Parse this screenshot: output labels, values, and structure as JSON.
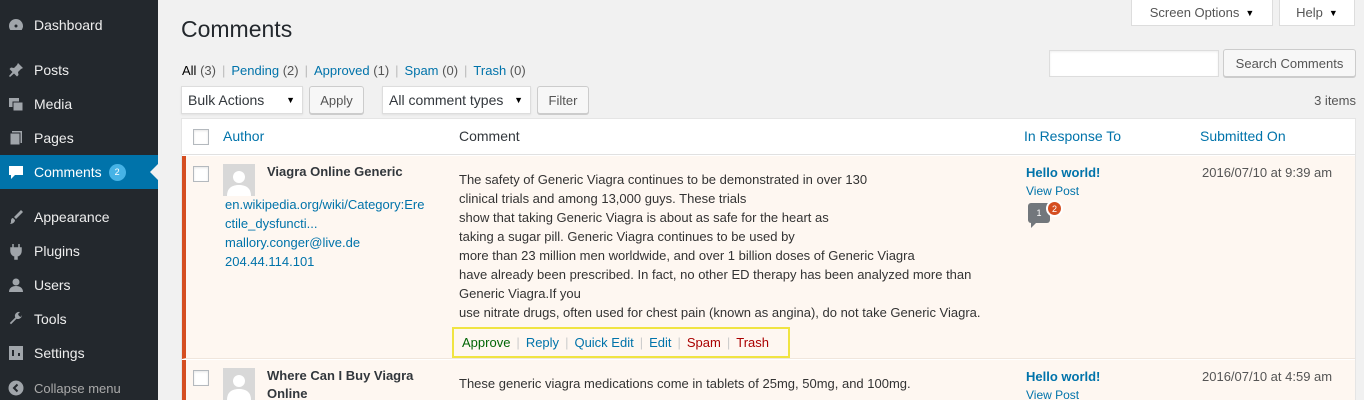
{
  "sidebar": {
    "items": [
      {
        "label": "Dashboard",
        "icon": "dashboard-icon"
      },
      {
        "label": "Posts",
        "icon": "pin-icon"
      },
      {
        "label": "Media",
        "icon": "media-icon"
      },
      {
        "label": "Pages",
        "icon": "pages-icon"
      },
      {
        "label": "Comments",
        "icon": "comment-icon",
        "badge": "2",
        "active": true
      },
      {
        "label": "Appearance",
        "icon": "brush-icon"
      },
      {
        "label": "Plugins",
        "icon": "plug-icon"
      },
      {
        "label": "Users",
        "icon": "user-icon"
      },
      {
        "label": "Tools",
        "icon": "wrench-icon"
      },
      {
        "label": "Settings",
        "icon": "settings-icon"
      }
    ],
    "collapse_label": "Collapse menu"
  },
  "top_tabs": {
    "screen_options": "Screen Options",
    "help": "Help"
  },
  "page_title": "Comments",
  "filters": {
    "all": {
      "label": "All",
      "count": "(3)"
    },
    "pending": {
      "label": "Pending",
      "count": "(2)"
    },
    "approved": {
      "label": "Approved",
      "count": "(1)"
    },
    "spam": {
      "label": "Spam",
      "count": "(0)"
    },
    "trash": {
      "label": "Trash",
      "count": "(0)"
    }
  },
  "search": {
    "button": "Search Comments",
    "value": ""
  },
  "bulk": {
    "selected": "Bulk Actions",
    "apply": "Apply"
  },
  "types": {
    "selected": "All comment types",
    "filter": "Filter"
  },
  "items_count": "3 items",
  "columns": {
    "author": "Author",
    "comment": "Comment",
    "response": "In Response To",
    "submitted": "Submitted On"
  },
  "rows": [
    {
      "author": "Viagra Online Generic",
      "url_line1": "en.wikipedia.org/wiki/Category:Ere",
      "url_line2": "ctile_dysfuncti...",
      "email": "mallory.conger@live.de",
      "ip": "204.44.114.101",
      "comment_lines": [
        "The safety of Generic Viagra continues to be demonstrated in over 130",
        "clinical trials and among 13,000 guys. These trials",
        "show that taking Generic Viagra is about as safe for the heart as",
        "taking a sugar pill. Generic Viagra continues to be used by",
        "more than 23 million men worldwide, and over 1 billion doses of Generic Viagra",
        "have already been prescribed. In fact, no other ED therapy has been analyzed more than",
        "Generic Viagra.If you",
        "use nitrate drugs, often used for chest pain (known as angina), do not take Generic Viagra."
      ],
      "actions": {
        "approve": "Approve",
        "reply": "Reply",
        "quick_edit": "Quick Edit",
        "edit": "Edit",
        "spam": "Spam",
        "trash": "Trash"
      },
      "response_title": "Hello world!",
      "view_post": "View Post",
      "approved_count": "1",
      "pending_count": "2",
      "submitted": "2016/07/10 at 9:39 am"
    },
    {
      "author_line1": "Where Can I Buy Viagra",
      "author_line2": "Online",
      "comment_line": "These generic viagra medications come in tablets of 25mg, 50mg, and 100mg.",
      "response_title": "Hello world!",
      "view_post": "View Post",
      "submitted": "2016/07/10 at 4:59 am"
    }
  ]
}
